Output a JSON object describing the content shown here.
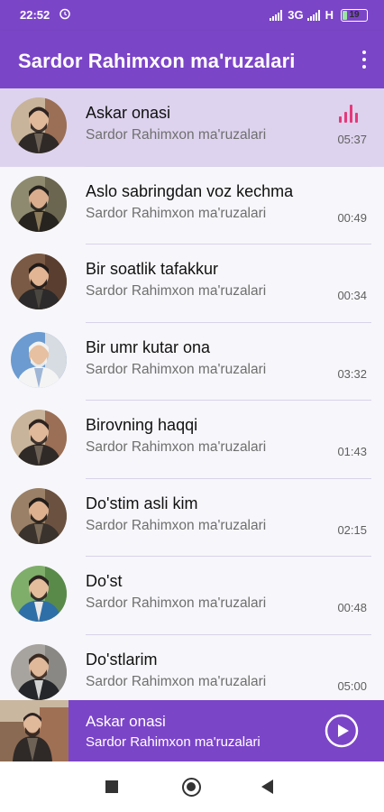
{
  "status_bar": {
    "time": "22:52",
    "network": "3G",
    "network2": "H",
    "battery": "19",
    "battery_level": 0.19
  },
  "app_bar": {
    "title": "Sardor Rahimxon ma'ruzalari"
  },
  "tracks": [
    {
      "title": "Askar onasi",
      "artist": "Sardor Rahimxon ma'ruzalari",
      "duration": "05:37",
      "playing": true
    },
    {
      "title": "Aslo sabringdan voz kechma",
      "artist": "Sardor Rahimxon ma'ruzalari",
      "duration": "00:49"
    },
    {
      "title": "Bir soatlik tafakkur",
      "artist": "Sardor Rahimxon ma'ruzalari",
      "duration": "00:34"
    },
    {
      "title": "Bir umr kutar ona",
      "artist": "Sardor Rahimxon ma'ruzalari",
      "duration": "03:32"
    },
    {
      "title": "Birovning haqqi",
      "artist": "Sardor Rahimxon ma'ruzalari",
      "duration": "01:43"
    },
    {
      "title": "Do'stim asli kim",
      "artist": "Sardor Rahimxon ma'ruzalari",
      "duration": "02:15"
    },
    {
      "title": "Do'st",
      "artist": "Sardor Rahimxon ma'ruzalari",
      "duration": "00:48"
    },
    {
      "title": "Do'stlarim",
      "artist": "Sardor Rahimxon ma'ruzalari",
      "duration": "05:00"
    }
  ],
  "now_playing": {
    "title": "Askar onasi",
    "artist": "Sardor Rahimxon ma'ruzalari"
  },
  "colors": {
    "accent": "#7b45c8",
    "active_row": "#ddd3ee",
    "equalizer": "#e5397a"
  },
  "icons": {
    "menu": "more-vert-icon",
    "play": "play-circle-icon",
    "playing": "equalizer-icon",
    "nav_recents": "square-icon",
    "nav_home": "circle-icon",
    "nav_back": "triangle-back-icon"
  }
}
